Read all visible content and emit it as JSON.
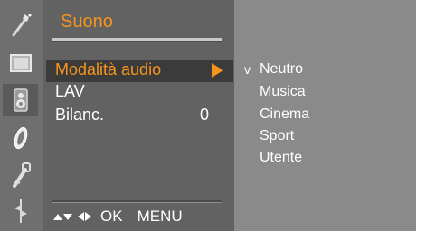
{
  "sidebar": {
    "icons": [
      {
        "name": "picture-wand-icon"
      },
      {
        "name": "screen-icon"
      },
      {
        "name": "speaker-icon",
        "active": true
      },
      {
        "name": "clock-icon"
      },
      {
        "name": "lock-key-icon"
      },
      {
        "name": "option-tool-icon"
      }
    ]
  },
  "menu": {
    "title": "Suono",
    "items": [
      {
        "label": "Modalità audio",
        "selected": true
      },
      {
        "label": "LAV"
      },
      {
        "label": "Bilanc.",
        "value": "0"
      }
    ]
  },
  "submenu": {
    "check_mark": "v",
    "options": [
      "Neutro",
      "Musica",
      "Cinema",
      "Sport",
      "Utente"
    ],
    "current": "Neutro"
  },
  "footer": {
    "ok_label": "OK",
    "menu_label": "MENU"
  },
  "colors": {
    "accent": "#f7941d",
    "text": "#ffffff",
    "panel": "#626262",
    "sidebar": "#6f6f6f",
    "submenu": "#8a8a8a",
    "highlight": "#3b3b3b"
  }
}
